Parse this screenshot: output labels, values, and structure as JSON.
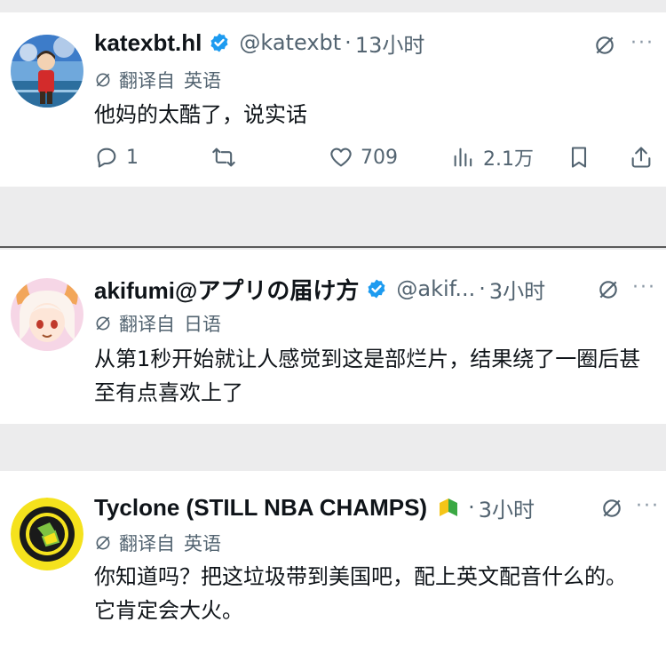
{
  "tweets": [
    {
      "name": "katexbt.hl",
      "handle": "@katexbt",
      "time": "13小时",
      "translate_label": "翻译自",
      "translate_lang": "英语",
      "text": "他妈的太酷了，说实话",
      "actions": {
        "reply_count": "1",
        "repost_count": "",
        "like_count": "709",
        "view_count": "2.1万"
      }
    },
    {
      "name": "akifumi@アプリの届け方",
      "handle": "@akif...",
      "time": "3小时",
      "translate_label": "翻译自",
      "translate_lang": "日语",
      "text": "从第1秒开始就让人感觉到这是部烂片，结果绕了一圈后甚至有点喜欢上了"
    },
    {
      "name": "Tyclone (STILL NBA CHAMPS)",
      "handle": "",
      "time": "3小时",
      "translate_label": "翻译自",
      "translate_lang": "英语",
      "text": "你知道吗？把这垃圾带到美国吧，配上英文配音什么的。它肯定会大火。"
    }
  ],
  "separator": "·",
  "more_glyph": "···",
  "icons": {
    "verified": "verified-badge-icon",
    "grok": "grok-icon",
    "reply": "reply-icon",
    "repost": "repost-icon",
    "like": "heart-icon",
    "views": "analytics-icon",
    "bookmark": "bookmark-icon",
    "share": "share-icon",
    "beginner": "beginner-badge-icon"
  },
  "colors": {
    "verified": "#1d9bf0",
    "text": "#0f1419",
    "secondary": "#536471"
  }
}
